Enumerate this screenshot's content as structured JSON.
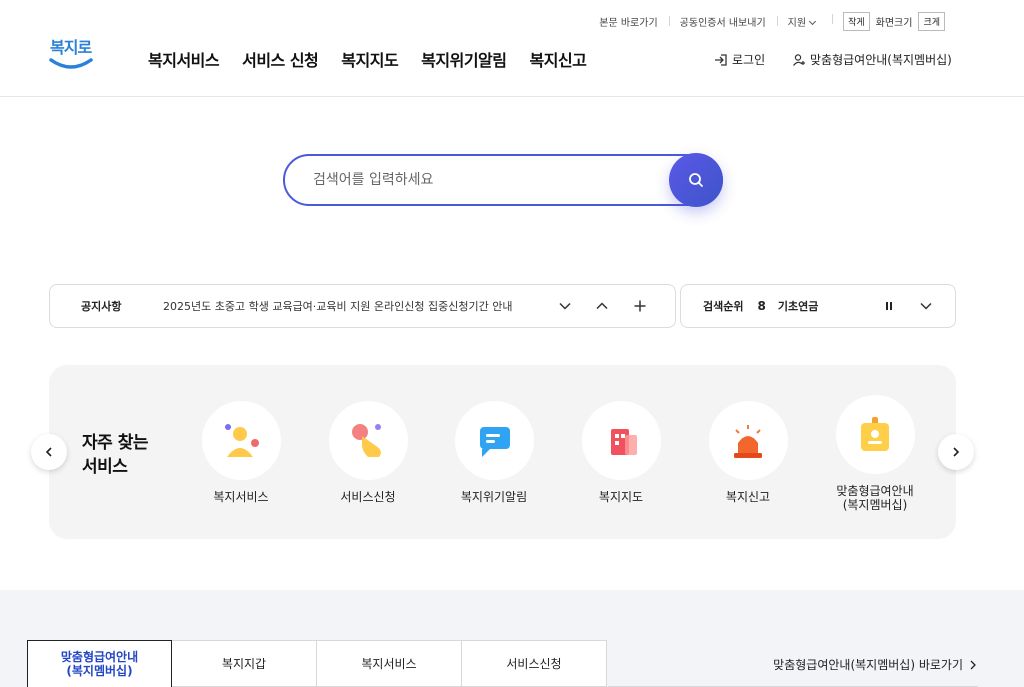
{
  "util": {
    "skip_to_content": "본문 바로가기",
    "cert_export": "공동인증서 내보내기",
    "support": "지원",
    "font_small": "작게",
    "font_label": "화면크기",
    "font_large": "크게"
  },
  "logo": {
    "text": "복지로"
  },
  "nav": [
    "복지서비스",
    "서비스 신청",
    "복지지도",
    "복지위기알림",
    "복지신고"
  ],
  "account": {
    "login": "로그인",
    "member": "맞춤형급여안내(복지멤버십)"
  },
  "search": {
    "placeholder": "검색어를 입력하세요"
  },
  "notice": {
    "title": "공지사항",
    "content": "2025년도 초중고 학생 교육급여·교육비 지원 온라인신청 집중신청기간 안내"
  },
  "rank": {
    "title": "검색순위",
    "number": "8",
    "keyword": "기초연금"
  },
  "frequent": {
    "title_line1": "자주 찾는",
    "title_line2": "서비스",
    "items": [
      {
        "label": "복지서비스",
        "icon": "people-icon"
      },
      {
        "label": "서비스신청",
        "icon": "hand-click-icon"
      },
      {
        "label": "복지위기알림",
        "icon": "message-icon"
      },
      {
        "label": "복지지도",
        "icon": "building-icon"
      },
      {
        "label": "복지신고",
        "icon": "siren-icon"
      },
      {
        "label_line1": "맞춤형급여안내",
        "label_line2": "(복지멤버십)",
        "icon": "badge-icon"
      }
    ]
  },
  "tabs": [
    {
      "line1": "맞춤형급여안내",
      "line2": "(복지멤버십)",
      "active": true
    },
    {
      "line1": "복지지갑"
    },
    {
      "line1": "복지서비스"
    },
    {
      "line1": "서비스신청"
    }
  ],
  "goto_link": "맞춤형급여안내(복지멤버십) 바로가기",
  "colors": {
    "accent": "#4a5ad8",
    "logo": "#2a82d8",
    "active_tab": "#2346c4"
  }
}
